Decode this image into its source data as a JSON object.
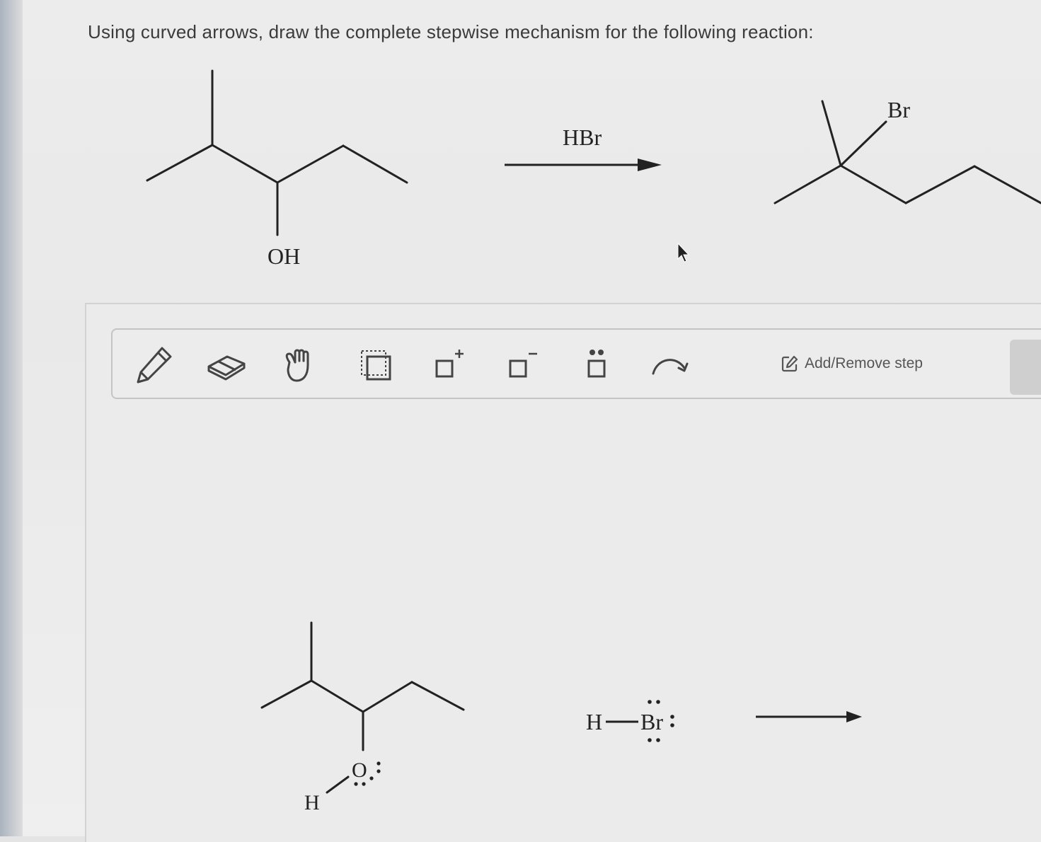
{
  "question": "Using curved arrows, draw the complete stepwise mechanism for the following reaction:",
  "reaction": {
    "reactant_label": "OH",
    "reagent": "HBr",
    "product_label": "Br"
  },
  "toolbar": {
    "tools": [
      {
        "name": "pencil-tool",
        "icon": "pencil-icon"
      },
      {
        "name": "eraser-tool",
        "icon": "eraser-icon"
      },
      {
        "name": "hand-tool",
        "icon": "hand-icon"
      },
      {
        "name": "select-tool",
        "icon": "dotted-select-icon"
      },
      {
        "name": "positive-charge-tool",
        "icon": "box-plus-icon",
        "label": "+"
      },
      {
        "name": "negative-charge-tool",
        "icon": "box-minus-icon",
        "label": "−"
      },
      {
        "name": "lone-pair-tool",
        "icon": "box-dots-icon"
      },
      {
        "name": "curved-arrow-tool",
        "icon": "curved-arrow-icon"
      }
    ],
    "add_remove_label": "Add/Remove step"
  },
  "step": {
    "oxygen_label": "O",
    "hydrogen_label": "H",
    "hbr_h_label": "H",
    "hbr_br_label": "Br"
  },
  "colors": {
    "ink": "#222222",
    "text": "#3b3b3b",
    "toolbar_border": "#c4c4c4",
    "icon": "#444444"
  }
}
